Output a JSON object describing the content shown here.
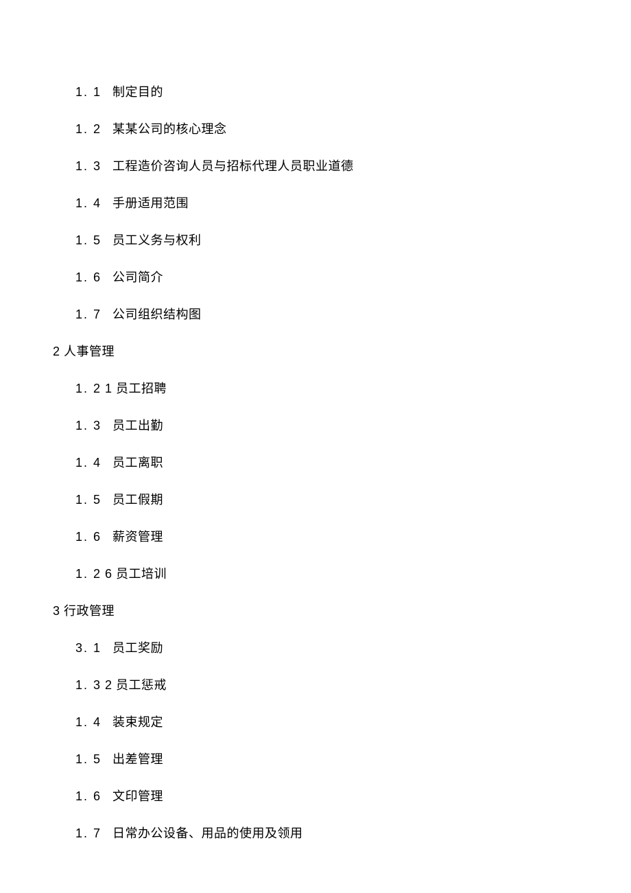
{
  "sections": [
    {
      "header": null,
      "items": [
        {
          "num": "1. 1",
          "label": "制定目的"
        },
        {
          "num": "1. 2",
          "label": "某某公司的核心理念"
        },
        {
          "num": "1. 3",
          "label": "工程造价咨询人员与招标代理人员职业道德"
        },
        {
          "num": "1. 4",
          "label": "手册适用范围"
        },
        {
          "num": "1. 5",
          "label": "员工义务与权利"
        },
        {
          "num": "1. 6",
          "label": "公司简介"
        },
        {
          "num": "1. 7",
          "label": "公司组织结构图"
        }
      ]
    },
    {
      "header": {
        "num": "2",
        "label": "人事管理"
      },
      "items": [
        {
          "num": "1. 2",
          "extra": "1",
          "label": "员工招聘",
          "tight": true
        },
        {
          "num": "1. 3",
          "label": "员工出勤"
        },
        {
          "num": "1. 4",
          "label": "员工离职"
        },
        {
          "num": "1. 5",
          "label": "员工假期"
        },
        {
          "num": "1. 6",
          "label": "薪资管理"
        },
        {
          "num": "1. 2",
          "extra": "6",
          "label": "员工培训",
          "tight": true
        }
      ]
    },
    {
      "header": {
        "num": "3",
        "label": "行政管理"
      },
      "items": [
        {
          "num": "3. 1",
          "label": "员工奖励"
        },
        {
          "num": "1. 3",
          "extra": "2",
          "label": "员工惩戒",
          "tight": true
        },
        {
          "num": "1. 4",
          "label": "装束规定"
        },
        {
          "num": "1. 5",
          "label": "出差管理"
        },
        {
          "num": "1. 6",
          "label": "文印管理"
        },
        {
          "num": "1. 7",
          "label": "日常办公设备、用品的使用及领用"
        }
      ]
    }
  ]
}
